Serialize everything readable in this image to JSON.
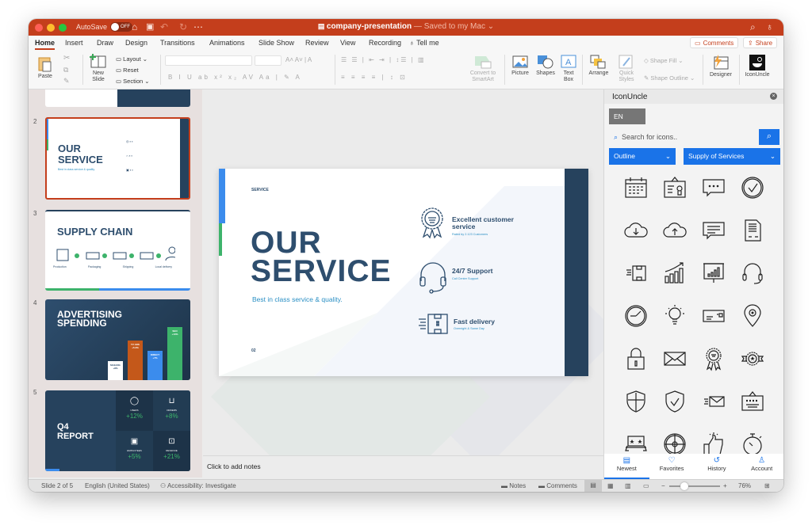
{
  "window": {
    "autosave_label": "AutoSave",
    "autosave_state": "OFF",
    "doc_name": "company-presentation",
    "doc_status": "— Saved to my Mac",
    "colors": {
      "brand": "#c43e1c",
      "accent_blue": "#1a73e8",
      "slide_navy": "#2e4e6e"
    }
  },
  "menu": {
    "tabs": [
      "Home",
      "Insert",
      "Draw",
      "Design",
      "Transitions",
      "Animations",
      "Slide Show",
      "Review",
      "View",
      "Recording"
    ],
    "active_tab": "Home",
    "tell_me": "Tell me",
    "comments": "Comments",
    "share": "Share"
  },
  "ribbon": {
    "paste": "Paste",
    "new_slide": "New\nSlide",
    "new_slide_l1": "New",
    "new_slide_l2": "Slide",
    "layout": "Layout",
    "reset": "Reset",
    "section": "Section",
    "font_name": "",
    "font_size": "",
    "convert_l1": "Convert to",
    "convert_l2": "SmartArt",
    "picture": "Picture",
    "shapes": "Shapes",
    "textbox_l1": "Text",
    "textbox_l2": "Box",
    "arrange": "Arrange",
    "quick_l1": "Quick",
    "quick_l2": "Styles",
    "shape_fill": "Shape Fill",
    "shape_outline": "Shape Outline",
    "designer": "Designer",
    "iconuncle": "IconUncle"
  },
  "thumbnails": [
    {
      "num": "2",
      "title_l1": "OUR",
      "title_l2": "SERVICE",
      "subtitle": "Best in class service & quality.",
      "selected": true
    },
    {
      "num": "3",
      "title": "SUPPLY CHAIN",
      "steps": [
        "Production",
        "Packaging",
        "Shipping",
        "Local delivery"
      ]
    },
    {
      "num": "4",
      "title_l1": "ADVERTISING",
      "title_l2": "SPENDING",
      "bars": [
        {
          "label": "MAILING",
          "value": "+8%"
        },
        {
          "label": "TV ADS",
          "value": "+5.3%"
        },
        {
          "label": "DIRECT",
          "value": "+7%"
        },
        {
          "label": "SEO",
          "value": "+13%"
        }
      ]
    },
    {
      "num": "5",
      "title_l1": "Q4",
      "title_l2": "REPORT",
      "kpis": [
        {
          "label": "USERS",
          "value": "+12%"
        },
        {
          "label": "ORDERS",
          "value": "+8%"
        },
        {
          "label": "EMPLOYEES",
          "value": "+5%"
        },
        {
          "label": "REVENUE",
          "value": "+21%"
        }
      ]
    }
  ],
  "slide": {
    "kicker": "SERVICE",
    "title_l1": "OUR",
    "title_l2": "SERVICE",
    "subtitle": "Best in class service & quality.",
    "page": "02",
    "features": [
      {
        "title_l1": "Excellent customer",
        "title_l2": "service",
        "sub": "Rated by 2.123 Customers",
        "icon": "award-ribbon-icon"
      },
      {
        "title_l1": "24/7 Support",
        "title_l2": "",
        "sub": "Call Center Support",
        "icon": "headset-icon"
      },
      {
        "title_l1": "Fast delivery",
        "title_l2": "",
        "sub": "Overnight & Same Day",
        "icon": "fast-box-icon"
      }
    ]
  },
  "notes": {
    "placeholder": "Click to add notes"
  },
  "panel": {
    "title": "IconUncle",
    "language": "EN",
    "search_placeholder": "Search for icons..",
    "style_select": "Outline",
    "category_select": "Supply of Services",
    "icons": [
      "calendar",
      "certificate",
      "chat-dots",
      "check-circle",
      "cloud-download",
      "cloud-upload",
      "message",
      "document",
      "fast-delivery",
      "growth-chart",
      "presentation",
      "headset",
      "clock",
      "lightbulb",
      "card",
      "location-pin",
      "lock",
      "envelope",
      "award",
      "star-badge",
      "shield",
      "shield-check",
      "fast-mail",
      "rating-board",
      "stars-banner",
      "target",
      "thumbs-up",
      "stopwatch"
    ],
    "footer": [
      "Newest",
      "Favorites",
      "History",
      "Account"
    ],
    "active_footer": "Newest"
  },
  "status": {
    "slide_info": "Slide 2 of 5",
    "language": "English (United States)",
    "accessibility": "Accessibility: Investigate",
    "notes": "Notes",
    "comments": "Comments",
    "zoom": "76%",
    "zoom_fraction": 0.3
  }
}
